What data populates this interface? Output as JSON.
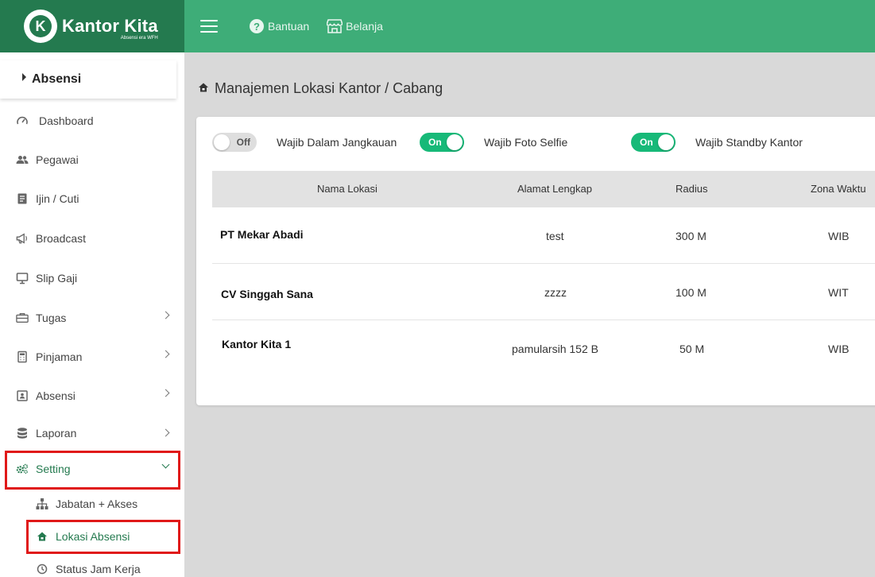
{
  "brand": {
    "logo_letter": "K",
    "name": "Kantor Kita",
    "tagline": "Absensi era WFH"
  },
  "topbar": {
    "menu_icon": "hamburger-icon",
    "links": [
      {
        "label": "Bantuan",
        "icon": "help-circle-icon"
      },
      {
        "label": "Belanja",
        "icon": "shop-icon"
      }
    ]
  },
  "sidebar": {
    "header": "Absensi",
    "items": [
      {
        "label": "Dashboard",
        "icon": "gauge-icon"
      },
      {
        "label": "Pegawai",
        "icon": "people-icon"
      },
      {
        "label": "Ijin / Cuti",
        "icon": "document-icon"
      },
      {
        "label": "Broadcast",
        "icon": "megaphone-icon"
      },
      {
        "label": "Slip Gaji",
        "icon": "monitor-icon"
      },
      {
        "label": "Tugas",
        "icon": "briefcase-icon"
      },
      {
        "label": "Pinjaman",
        "icon": "calculator-icon"
      },
      {
        "label": "Absensi",
        "icon": "id-card-icon"
      },
      {
        "label": "Laporan",
        "icon": "database-icon"
      },
      {
        "label": "Setting",
        "icon": "gears-icon"
      }
    ],
    "sub_items": [
      {
        "label": "Jabatan + Akses",
        "icon": "sitemap-icon"
      },
      {
        "label": "Lokasi Absensi",
        "icon": "home-icon"
      },
      {
        "label": "Status Jam Kerja",
        "icon": "clock-icon"
      }
    ]
  },
  "page": {
    "title": "Manajemen Lokasi Kantor / Cabang"
  },
  "toggles": [
    {
      "state_label": "Off",
      "on": false,
      "caption": "Wajib Dalam Jangkauan"
    },
    {
      "state_label": "On",
      "on": true,
      "caption": "Wajib Foto Selfie"
    },
    {
      "state_label": "On",
      "on": true,
      "caption": "Wajib Standby Kantor"
    }
  ],
  "table": {
    "columns": [
      "Nama Lokasi",
      "Alamat Lengkap",
      "Radius",
      "Zona Waktu"
    ],
    "rows": [
      {
        "name": "PT Mekar Abadi",
        "address": "test",
        "radius": "300 M",
        "zone": "WIB"
      },
      {
        "name": "CV Singgah Sana",
        "address": "zzzz",
        "radius": "100 M",
        "zone": "WIT"
      },
      {
        "name": "Kantor Kita 1",
        "address": "pamularsih 152 B",
        "radius": "50 M",
        "zone": "WIB"
      }
    ]
  },
  "colors": {
    "brand_dark": "#247a4f",
    "topbar": "#3ead78",
    "toggle_on": "#17b978",
    "highlight_box": "#e01919"
  }
}
